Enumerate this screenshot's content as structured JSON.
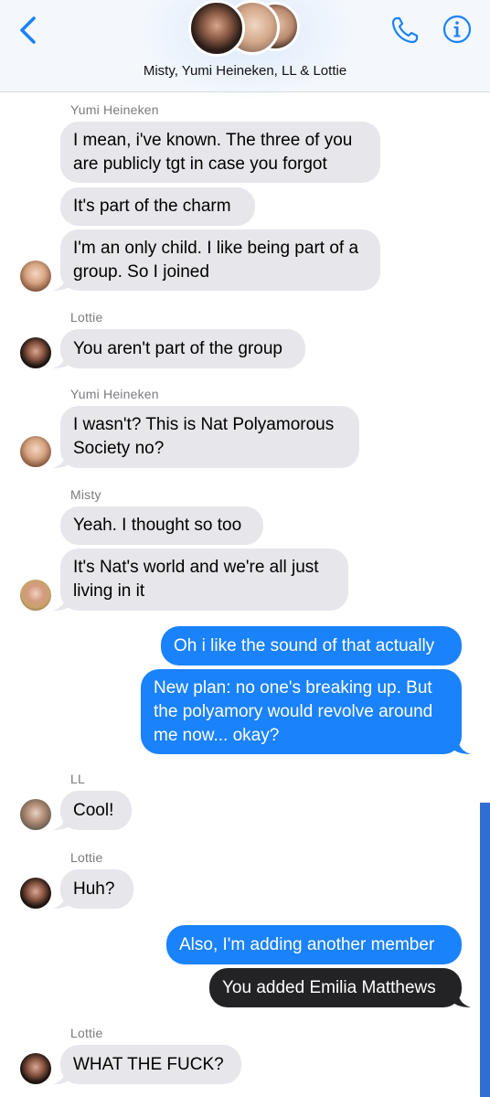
{
  "header": {
    "title": "Misty, Yumi Heineken, LL & Lottie",
    "back_icon": "chevron-left-icon",
    "call_icon": "phone-icon",
    "info_icon": "info-icon",
    "accent_color": "#1a82fb"
  },
  "messages": {
    "s1": "Yumi Heineken",
    "m1": "I mean, i've known. The three of you are publicly tgt in case you forgot",
    "m2": "It's part of the charm",
    "m3": "I'm an only child. I like being part of a group. So I joined",
    "s2": "Lottie",
    "m4": "You aren't part of the group",
    "s3": "Yumi Heineken",
    "m5": "I wasn't? This is Nat Polyamorous Society no?",
    "s4": "Misty",
    "m6": "Yeah. I thought so too",
    "m7": "It's Nat's world and we're all just living in it",
    "o1": "Oh i like the sound of that actually",
    "o2": "New plan: no one's breaking up. But the polyamory would revolve around me now... okay?",
    "s5": "LL",
    "m8": "Cool!",
    "s6": "Lottie",
    "m9": "Huh?",
    "o3": "Also, I'm adding another member",
    "sys1": "You added Emilia Matthews",
    "s7": "Lottie",
    "m10": "WHAT THE FUCK?"
  }
}
